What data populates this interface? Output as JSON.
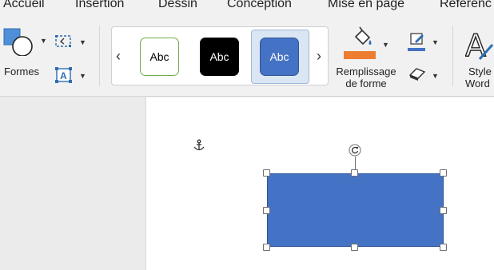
{
  "tabs": [
    "Accueil",
    "Insertion",
    "Dessin",
    "Conception",
    "Mise en page",
    "Référenc"
  ],
  "ribbon": {
    "shapes_label": "Formes",
    "gallery": {
      "prev": "‹",
      "next": "›",
      "styles": [
        "Abc",
        "Abc",
        "Abc"
      ]
    },
    "fill_label_line1": "Remplissage",
    "fill_label_line2": "de forme",
    "wordart_label_line1": "Style",
    "wordart_label_line2": "Word"
  },
  "colors": {
    "fill_accent": "#ed7d31",
    "outline_accent": "#4472c4",
    "shape_fill": "#4472c4",
    "style1_border": "#70ad47",
    "style2_fill": "#000000",
    "style3_fill": "#4472c4"
  },
  "icons": [
    "shapes-icon",
    "edit-points-icon",
    "text-box-icon",
    "paint-bucket-icon",
    "pen-outline-icon",
    "eraser-icon",
    "wordart-a-icon",
    "anchor-icon",
    "rotate-handle-icon"
  ]
}
